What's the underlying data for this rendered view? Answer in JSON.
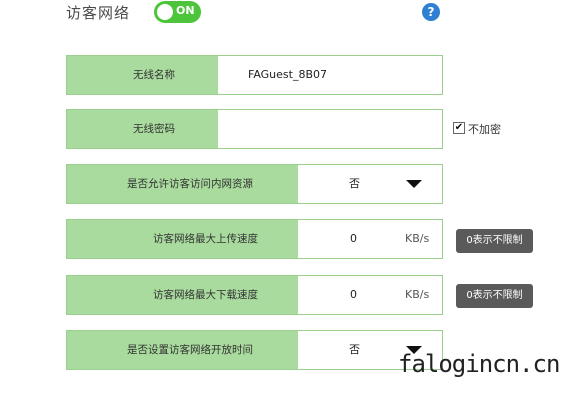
{
  "header": {
    "title": "访客网络",
    "toggle_label": "ON",
    "help_label": "?"
  },
  "colors": {
    "row_background": "#a8db9d",
    "toggle_on": "#4cc53a",
    "help_icon": "#2f7fd3",
    "hint_badge": "#5a5a5a"
  },
  "ssid": {
    "label": "无线名称",
    "value": "FAGuest_8B07"
  },
  "password": {
    "label": "无线密码",
    "value": "",
    "no_encryption_checked": true,
    "no_encryption_label": "不加密"
  },
  "intranet_access": {
    "label": "是否允许访客访问内网资源",
    "value": "否",
    "icon": "chevron-down-icon"
  },
  "upload_limit": {
    "label": "访客网络最大上传速度",
    "value": "0",
    "unit": "KB/s",
    "hint": "0表示不限制"
  },
  "download_limit": {
    "label": "访客网络最大下载速度",
    "value": "0",
    "unit": "KB/s",
    "hint": "0表示不限制"
  },
  "open_time": {
    "label": "是否设置访客网络开放时间",
    "value": "否",
    "icon": "chevron-down-icon"
  },
  "watermark": "falogincn.cn"
}
